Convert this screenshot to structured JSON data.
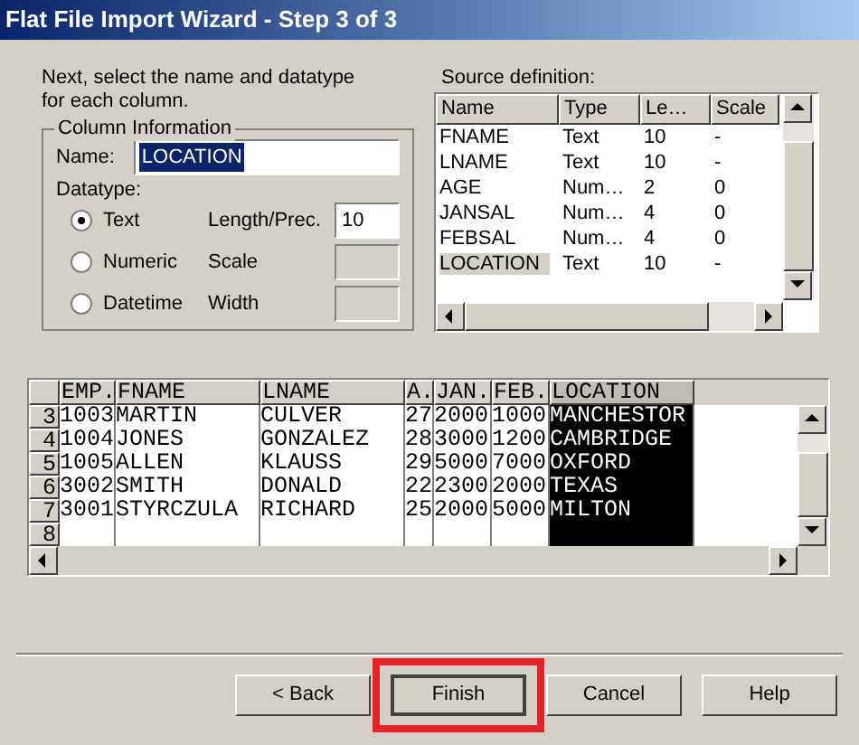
{
  "window": {
    "title": "Flat File Import Wizard - Step 3 of 3"
  },
  "instructions": "Next, select the name and datatype for each column.",
  "column_info": {
    "legend": "Column Information",
    "name_label": "Name:",
    "name_value": "LOCATION",
    "datatype_label": "Datatype:",
    "datatypes": [
      {
        "label": "Text",
        "selected": true
      },
      {
        "label": "Numeric",
        "selected": false
      },
      {
        "label": "Datetime",
        "selected": false
      }
    ],
    "params": [
      {
        "label": "Length/Prec.",
        "value": "10",
        "disabled": false
      },
      {
        "label": "Scale",
        "disabled": true
      },
      {
        "label": "Width",
        "disabled": true
      }
    ]
  },
  "source_definition": {
    "label": "Source definition:",
    "columns": [
      "Name",
      "Type",
      "Le…",
      "Scale"
    ],
    "rows": [
      {
        "cells": [
          "FNAME",
          "Text",
          "10",
          "-"
        ],
        "selected": false
      },
      {
        "cells": [
          "LNAME",
          "Text",
          "10",
          "-"
        ],
        "selected": false
      },
      {
        "cells": [
          "AGE",
          "Num…",
          "2",
          "0"
        ],
        "selected": false
      },
      {
        "cells": [
          "JANSAL",
          "Num…",
          "4",
          "0"
        ],
        "selected": false
      },
      {
        "cells": [
          "FEBSAL",
          "Num…",
          "4",
          "0"
        ],
        "selected": false
      },
      {
        "cells": [
          "LOCATION",
          "Text",
          "10",
          "-"
        ],
        "selected": true
      }
    ]
  },
  "preview": {
    "columns": [
      {
        "label": "EMP.",
        "selected": false
      },
      {
        "label": "FNAME",
        "selected": false
      },
      {
        "label": "LNAME",
        "selected": false
      },
      {
        "label": "A.",
        "selected": false
      },
      {
        "label": "JAN.",
        "selected": false
      },
      {
        "label": "FEB.",
        "selected": false
      },
      {
        "label": "LOCATION",
        "selected": true
      }
    ],
    "rows": [
      {
        "number": "3",
        "cells": [
          "1003",
          "MARTIN",
          "CULVER",
          "27",
          "2000",
          "1000",
          "MANCHESTOR"
        ]
      },
      {
        "number": "4",
        "cells": [
          "1004",
          "JONES",
          "GONZALEZ",
          "28",
          "3000",
          "1200",
          "CAMBRIDGE"
        ]
      },
      {
        "number": "5",
        "cells": [
          "1005",
          "ALLEN",
          "KLAUSS",
          "29",
          "5000",
          "7000",
          "OXFORD"
        ]
      },
      {
        "number": "6",
        "cells": [
          "3002",
          "SMITH",
          "DONALD",
          "22",
          "2300",
          "2000",
          "TEXAS"
        ]
      },
      {
        "number": "7",
        "cells": [
          "3001",
          "STYRCZULA",
          "RICHARD",
          "25",
          "2000",
          "5000",
          "MILTON"
        ]
      },
      {
        "number": "8"
      }
    ]
  },
  "buttons": [
    {
      "label": "< Back",
      "default": false,
      "highlighted": false
    },
    {
      "label": "Finish",
      "default": true,
      "highlighted": true
    },
    {
      "label": "Cancel",
      "default": false,
      "highlighted": false
    },
    {
      "label": "Help",
      "default": false,
      "highlighted": false
    }
  ]
}
